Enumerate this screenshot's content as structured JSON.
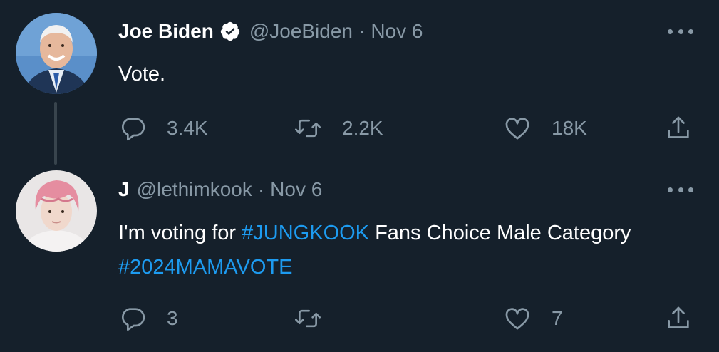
{
  "tweets": [
    {
      "display_name": "Joe Biden",
      "verified": true,
      "handle": "@JoeBiden",
      "separator": "·",
      "time": "Nov 6",
      "text": "Vote.",
      "replies": "3.4K",
      "retweets": "2.2K",
      "likes": "18K",
      "avatar_icon": "avatar-photo-man-suit"
    },
    {
      "display_name": "J",
      "verified": false,
      "handle": "@lethimkook",
      "separator": "·",
      "time": "Nov 6",
      "text_parts": [
        "I'm voting for ",
        "#JUNGKOOK",
        " Fans Choice Male Category ",
        "#2024MAMAVOTE"
      ],
      "replies": "3",
      "retweets": "",
      "likes": "7",
      "avatar_icon": "avatar-photo-pink-hair"
    }
  ],
  "colors": {
    "background": "#15202b",
    "primary_text": "#ffffff",
    "secondary_text": "#8899a6",
    "hashtag": "#1d9bf0",
    "thread_line": "#38444d"
  },
  "icons": [
    "reply-icon",
    "retweet-icon",
    "like-icon",
    "share-icon",
    "more-icon",
    "verified-badge-icon"
  ]
}
